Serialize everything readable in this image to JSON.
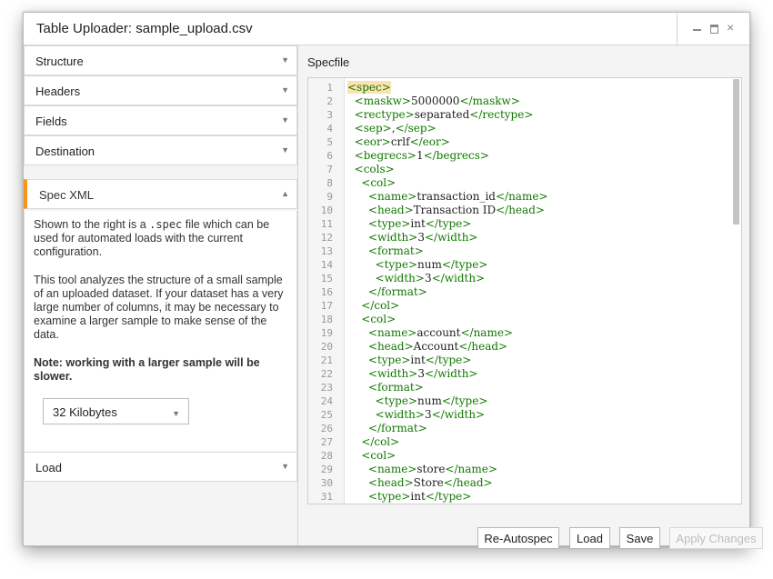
{
  "window": {
    "title": "Table Uploader: sample_upload.csv",
    "controls": {
      "minimize": "minimize-icon",
      "maximize": "maximize-icon",
      "close": "×"
    }
  },
  "accordion": {
    "items": [
      {
        "label": "Structure",
        "arrow": "▼"
      },
      {
        "label": "Headers",
        "arrow": "▼"
      },
      {
        "label": "Fields",
        "arrow": "▼"
      },
      {
        "label": "Destination",
        "arrow": "▼"
      },
      {
        "label": "Spec XML",
        "arrow": "▲"
      },
      {
        "label": "Load",
        "arrow": "▼"
      }
    ],
    "accent_color": "#f7941e"
  },
  "spec_xml": {
    "p1_before": "Shown to the right is a ",
    "p1_code": ".spec",
    "p1_after": " file which can be used for automated loads with the current configuration.",
    "p2": "This tool analyzes the structure of a small sample of an uploaded dataset. If your dataset has a very large number of columns, it may be necessary to examine a larger sample to make sense of the data.",
    "note": "Note: working with a larger sample will be slower.",
    "sample_size": "32 Kilobytes",
    "sample_arrow": "▼"
  },
  "specfile": {
    "label": "Specfile",
    "lines": [
      {
        "indent": "",
        "open": "<spec>",
        "text": "",
        "close": ""
      },
      {
        "indent": "  ",
        "open": "<maskw>",
        "text": "5000000",
        "close": "</maskw>"
      },
      {
        "indent": "  ",
        "open": "<rectype>",
        "text": "separated",
        "close": "</rectype>"
      },
      {
        "indent": "  ",
        "open": "<sep>",
        "text": ",",
        "close": "</sep>"
      },
      {
        "indent": "  ",
        "open": "<eor>",
        "text": "crlf",
        "close": "</eor>"
      },
      {
        "indent": "  ",
        "open": "<begrecs>",
        "text": "1",
        "close": "</begrecs>"
      },
      {
        "indent": "  ",
        "open": "<cols>",
        "text": "",
        "close": ""
      },
      {
        "indent": "    ",
        "open": "<col>",
        "text": "",
        "close": ""
      },
      {
        "indent": "      ",
        "open": "<name>",
        "text": "transaction_id",
        "close": "</name>"
      },
      {
        "indent": "      ",
        "open": "<head>",
        "text": "Transaction ID",
        "close": "</head>"
      },
      {
        "indent": "      ",
        "open": "<type>",
        "text": "int",
        "close": "</type>"
      },
      {
        "indent": "      ",
        "open": "<width>",
        "text": "3",
        "close": "</width>"
      },
      {
        "indent": "      ",
        "open": "<format>",
        "text": "",
        "close": ""
      },
      {
        "indent": "        ",
        "open": "<type>",
        "text": "num",
        "close": "</type>"
      },
      {
        "indent": "        ",
        "open": "<width>",
        "text": "3",
        "close": "</width>"
      },
      {
        "indent": "      ",
        "open": "</format>",
        "text": "",
        "close": ""
      },
      {
        "indent": "    ",
        "open": "</col>",
        "text": "",
        "close": ""
      },
      {
        "indent": "    ",
        "open": "<col>",
        "text": "",
        "close": ""
      },
      {
        "indent": "      ",
        "open": "<name>",
        "text": "account",
        "close": "</name>"
      },
      {
        "indent": "      ",
        "open": "<head>",
        "text": "Account",
        "close": "</head>"
      },
      {
        "indent": "      ",
        "open": "<type>",
        "text": "int",
        "close": "</type>"
      },
      {
        "indent": "      ",
        "open": "<width>",
        "text": "3",
        "close": "</width>"
      },
      {
        "indent": "      ",
        "open": "<format>",
        "text": "",
        "close": ""
      },
      {
        "indent": "        ",
        "open": "<type>",
        "text": "num",
        "close": "</type>"
      },
      {
        "indent": "        ",
        "open": "<width>",
        "text": "3",
        "close": "</width>"
      },
      {
        "indent": "      ",
        "open": "</format>",
        "text": "",
        "close": ""
      },
      {
        "indent": "    ",
        "open": "</col>",
        "text": "",
        "close": ""
      },
      {
        "indent": "    ",
        "open": "<col>",
        "text": "",
        "close": ""
      },
      {
        "indent": "      ",
        "open": "<name>",
        "text": "store",
        "close": "</name>"
      },
      {
        "indent": "      ",
        "open": "<head>",
        "text": "Store",
        "close": "</head>"
      },
      {
        "indent": "      ",
        "open": "<type>",
        "text": "int",
        "close": "</type>"
      }
    ],
    "tag_color": "#117700",
    "highlight_color": "#fbe2b0"
  },
  "buttons": {
    "reautospec": "Re-Autospec",
    "load": "Load",
    "save": "Save",
    "apply": "Apply Changes"
  }
}
